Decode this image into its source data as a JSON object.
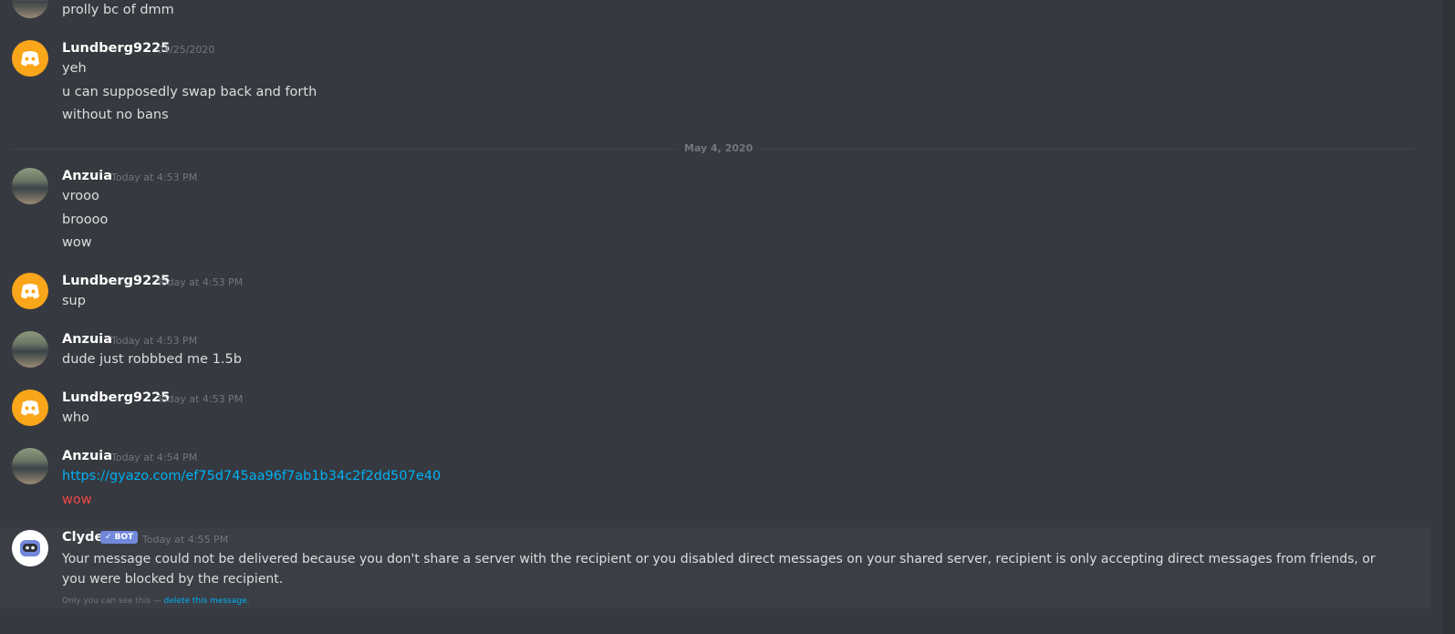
{
  "messages": {
    "m0": {
      "line1": "prolly bc of dmm"
    },
    "m1": {
      "author": "Lundberg9225",
      "time": "04/25/2020",
      "line1": "yeh",
      "line2": "u can supposedly swap back and forth",
      "line3": "without no bans"
    },
    "divider": "May 4, 2020",
    "m2": {
      "author": "Anzuia",
      "time": "Today at 4:53 PM",
      "line1": "vrooo",
      "line2": "broooo",
      "line3": "wow"
    },
    "m3": {
      "author": "Lundberg9225",
      "time": "Today at 4:53 PM",
      "line1": "sup"
    },
    "m4": {
      "author": "Anzuia",
      "time": "Today at 4:53 PM",
      "line1": "dude just robbbed me 1.5b"
    },
    "m5": {
      "author": "Lundberg9225",
      "time": "Today at 4:53 PM",
      "line1": "who"
    },
    "m6": {
      "author": "Anzuia",
      "time": "Today at 4:54 PM",
      "link": "https://gyazo.com/ef75d745aa96f7ab1b34c2f2dd507e40",
      "line2": "wow"
    },
    "bot": {
      "author": "Clyde",
      "badge": "✓ BOT",
      "time": "Today at 4:55 PM",
      "text": "Your message could not be delivered because you don't share a server with the recipient or you disabled direct messages on your shared server, recipient is only accepting direct messages from friends, or you were blocked by the recipient.",
      "note_prefix": "Only you can see this — ",
      "note_link": "delete this message."
    }
  },
  "colors": {
    "background": "#36393f",
    "discord_avatar": "#faa61a",
    "link": "#00b0f4",
    "bot_badge": "#7289da",
    "red_text": "#f04747"
  }
}
